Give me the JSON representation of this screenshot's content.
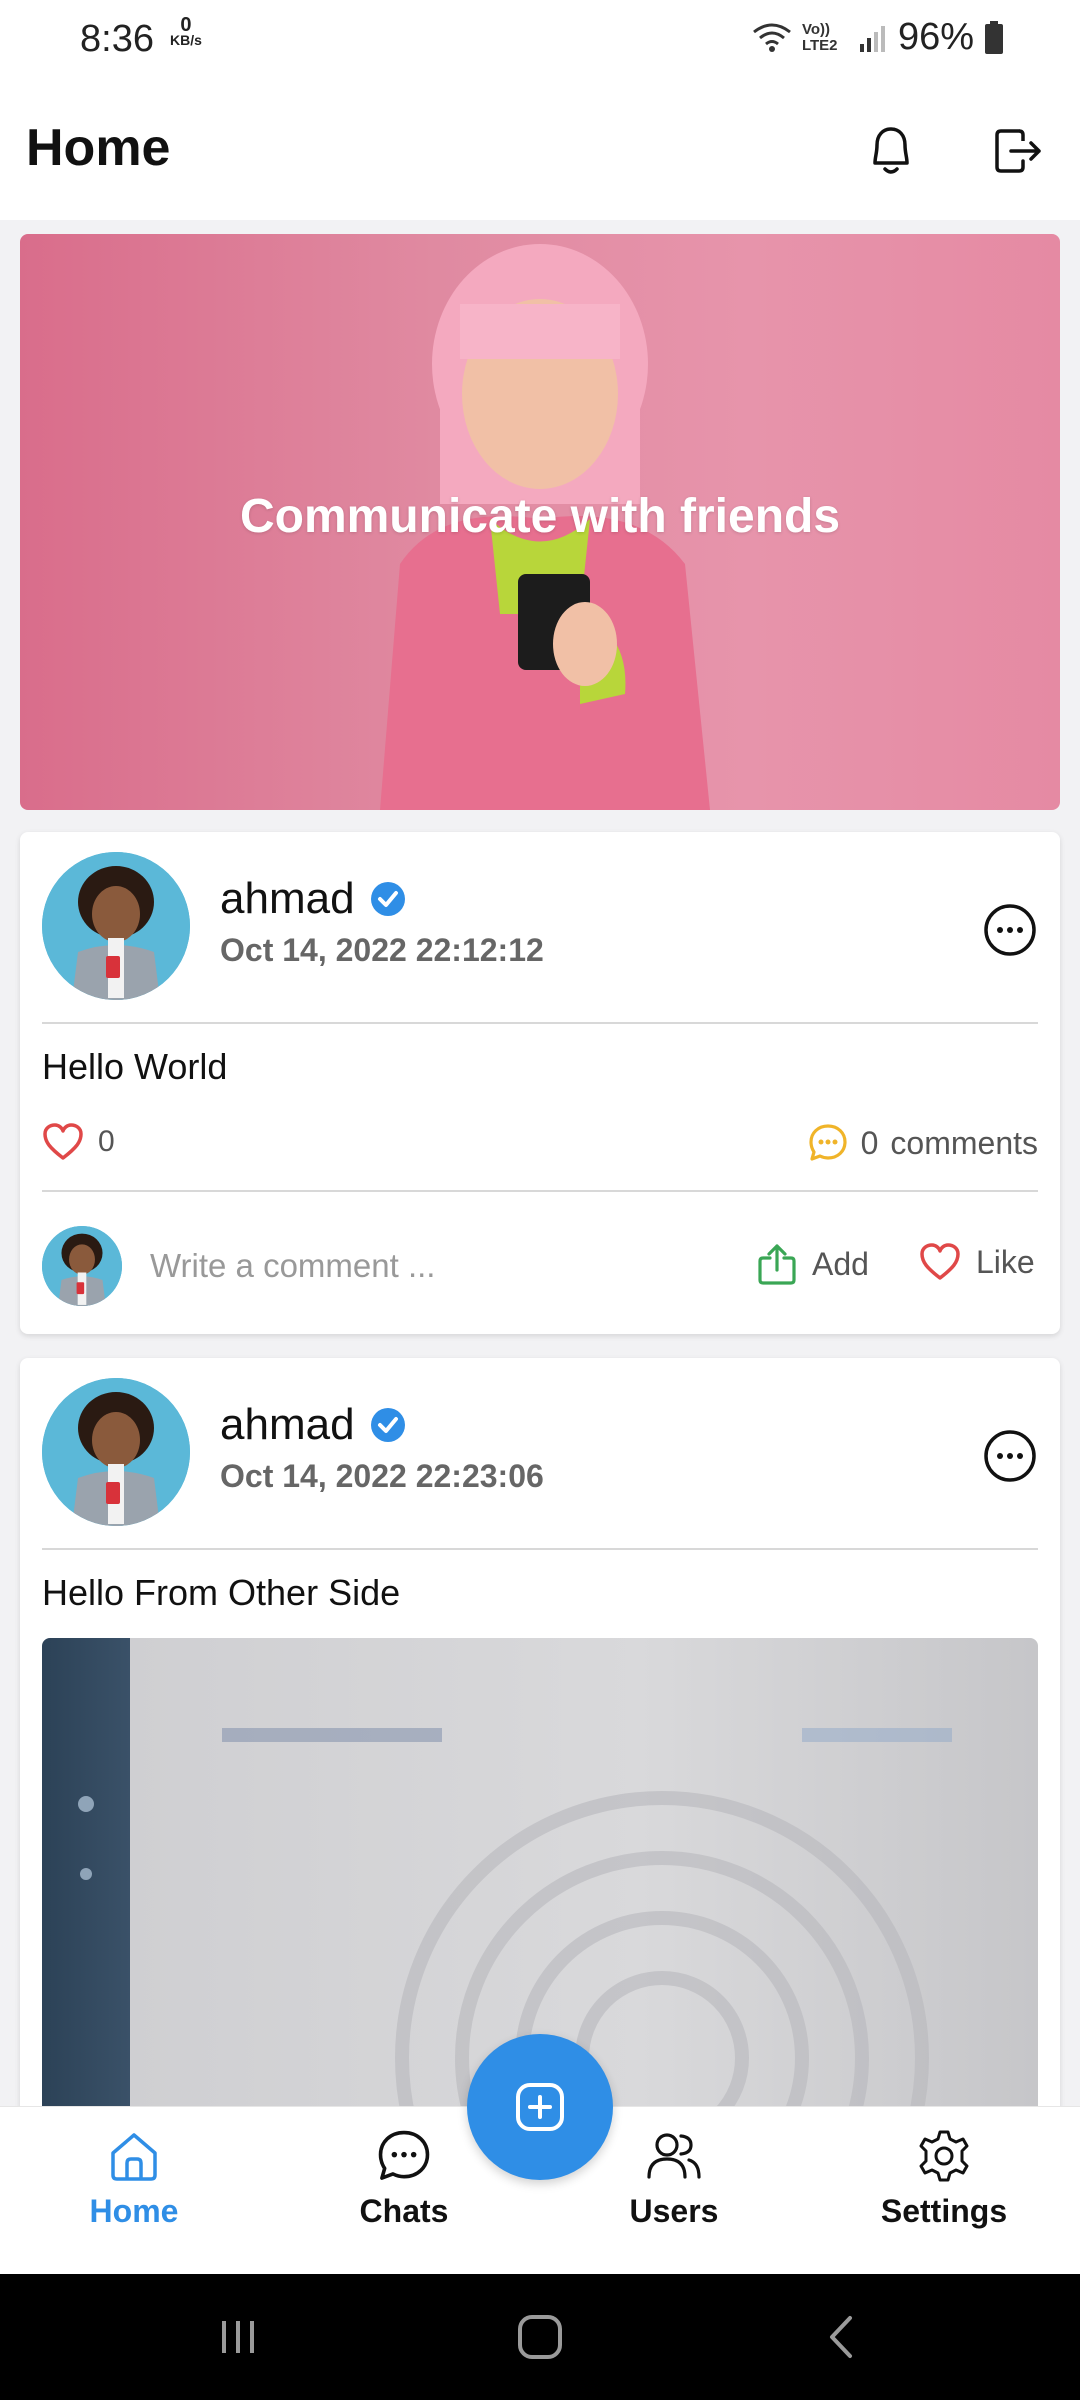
{
  "status_bar": {
    "time": "8:36",
    "net_speed_value": "0",
    "net_speed_unit": "KB/s",
    "network_label": "Vo)) LTE2",
    "battery": "96%"
  },
  "header": {
    "title": "Home",
    "notification_icon": "bell-icon",
    "logout_icon": "logout-icon"
  },
  "banner": {
    "title": "Communicate with friends"
  },
  "posts": [
    {
      "author": "ahmad",
      "verified": true,
      "date": "Oct 14, 2022 22:12:12",
      "text": "Hello World",
      "likes": "0",
      "comments": "0",
      "comments_label": "comments",
      "comment_placeholder": "Write a comment ...",
      "add_label": "Add",
      "like_label": "Like"
    },
    {
      "author": "ahmad",
      "verified": true,
      "date": "Oct 14, 2022 22:23:06",
      "text": "Hello From Other Side"
    }
  ],
  "bottom_nav": {
    "items": [
      {
        "label": "Home",
        "icon": "home-icon",
        "active": true
      },
      {
        "label": "Chats",
        "icon": "chat-icon",
        "active": false
      },
      {
        "label": "Users",
        "icon": "users-icon",
        "active": false
      },
      {
        "label": "Settings",
        "icon": "settings-icon",
        "active": false
      }
    ],
    "fab_icon": "add-post-icon"
  },
  "colors": {
    "accent": "#2f8ee6",
    "like": "#e04848",
    "comment": "#f0b429",
    "add": "#3aa655"
  }
}
